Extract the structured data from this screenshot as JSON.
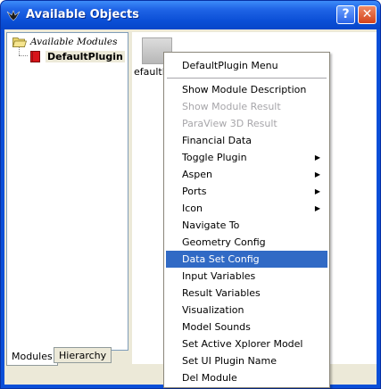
{
  "window": {
    "title": "Available Objects",
    "help_label": "?",
    "close_label": "✕"
  },
  "tree": {
    "root_label": "Available Modules",
    "child_label": "DefaultPlugin"
  },
  "tabs": [
    {
      "label": "Modules"
    },
    {
      "label": "Hierarchy"
    }
  ],
  "canvas": {
    "module_label": "efaultP"
  },
  "menu": {
    "title": "DefaultPlugin Menu",
    "items": [
      {
        "label": "Show Module Description",
        "disabled": false,
        "submenu": false
      },
      {
        "label": "Show Module Result",
        "disabled": true,
        "submenu": false
      },
      {
        "label": "ParaView 3D Result",
        "disabled": true,
        "submenu": false
      },
      {
        "label": "Financial Data",
        "disabled": false,
        "submenu": false
      },
      {
        "label": "Toggle Plugin",
        "disabled": false,
        "submenu": true
      },
      {
        "label": "Aspen",
        "disabled": false,
        "submenu": true
      },
      {
        "label": "Ports",
        "disabled": false,
        "submenu": true
      },
      {
        "label": "Icon",
        "disabled": false,
        "submenu": true
      },
      {
        "label": "Navigate To",
        "disabled": false,
        "submenu": false
      },
      {
        "label": "Geometry Config",
        "disabled": false,
        "submenu": false
      },
      {
        "label": "Data Set Config",
        "disabled": false,
        "submenu": false,
        "highlighted": true
      },
      {
        "label": "Input Variables",
        "disabled": false,
        "submenu": false
      },
      {
        "label": "Result Variables",
        "disabled": false,
        "submenu": false
      },
      {
        "label": "Visualization",
        "disabled": false,
        "submenu": false
      },
      {
        "label": "Model Sounds",
        "disabled": false,
        "submenu": false
      },
      {
        "label": "Set Active Xplorer Model",
        "disabled": false,
        "submenu": false
      },
      {
        "label": "Set UI Plugin Name",
        "disabled": false,
        "submenu": false
      },
      {
        "label": "Del Module",
        "disabled": false,
        "submenu": false
      }
    ],
    "submenu_arrow": "▶"
  },
  "colors": {
    "titlebar": "#0b4fd6",
    "highlight": "#316ac5",
    "disabled_text": "#a7a6aa",
    "window_bg": "#ece9d8"
  }
}
